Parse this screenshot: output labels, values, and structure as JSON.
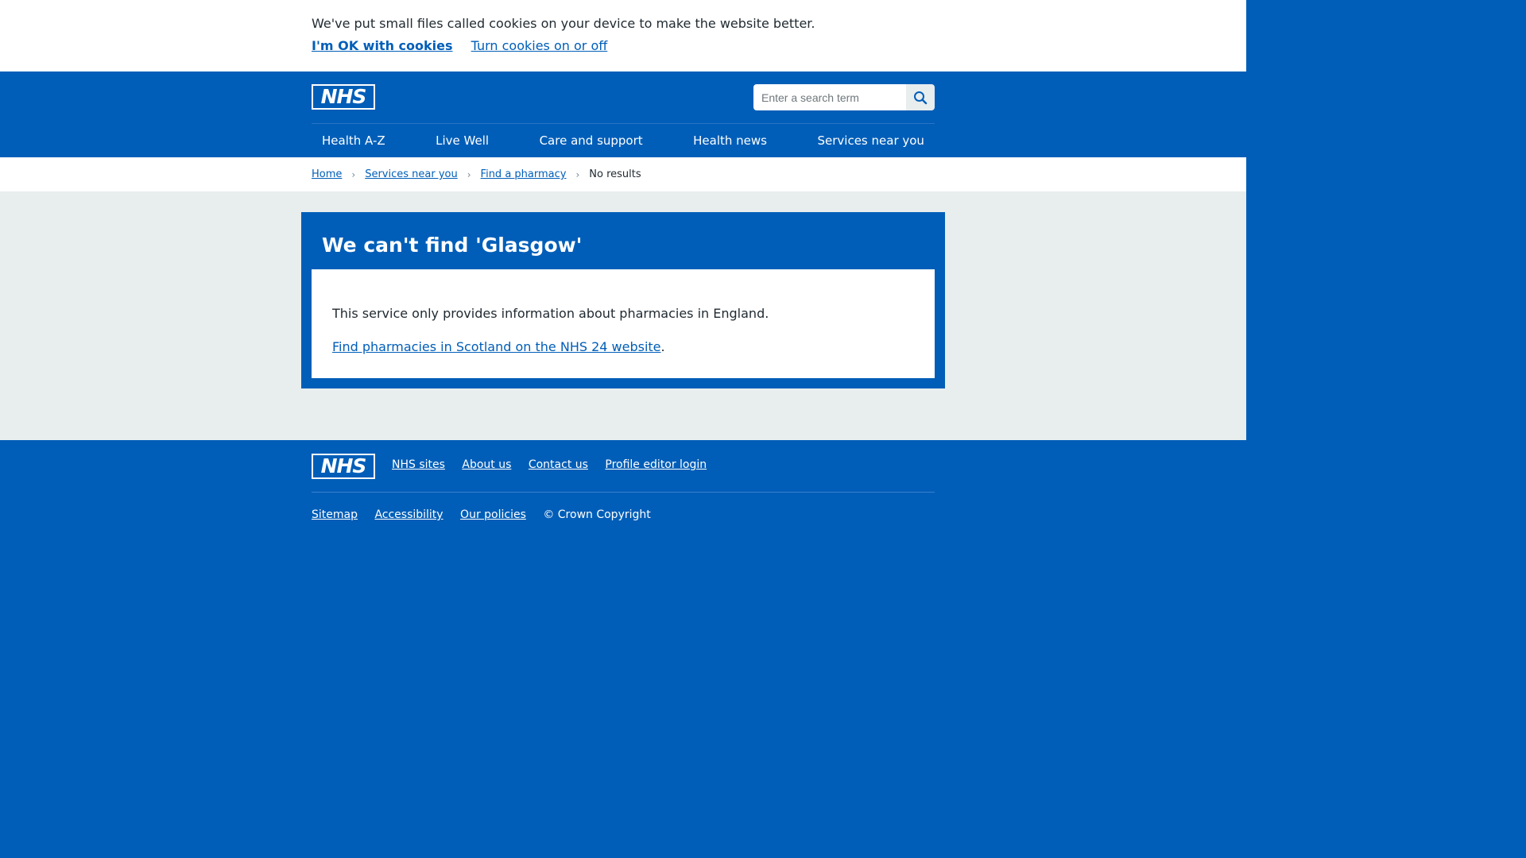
{
  "cookie_banner": {
    "message": "We've put small files called cookies on your device to make the website better.",
    "accept_label": "I'm OK with cookies",
    "settings_label": "Turn cookies on or off"
  },
  "header": {
    "logo_text": "NHS",
    "search": {
      "placeholder": "Enter a search term",
      "button_icon": "search-icon"
    },
    "nav": [
      "Health A-Z",
      "Live Well",
      "Care and support",
      "Health news",
      "Services near you"
    ]
  },
  "breadcrumb": {
    "items": [
      "Home",
      "Services near you",
      "Find a pharmacy"
    ],
    "current": "No results"
  },
  "result": {
    "heading": "We can't find 'Glasgow'",
    "message": "This service only provides information about pharmacies in England.",
    "link_text": "Find pharmacies in Scotland on the NHS 24 website",
    "link_suffix": "."
  },
  "footer": {
    "logo_text": "NHS",
    "primary_links": [
      "NHS sites",
      "About us",
      "Contact us",
      "Profile editor login"
    ],
    "secondary_links": [
      "Sitemap",
      "Accessibility",
      "Our policies"
    ],
    "copyright": "© Crown Copyright"
  },
  "colors": {
    "nhs_blue": "#005eb8",
    "page_grey": "#e8edee",
    "text": "#212b32",
    "white": "#ffffff"
  }
}
